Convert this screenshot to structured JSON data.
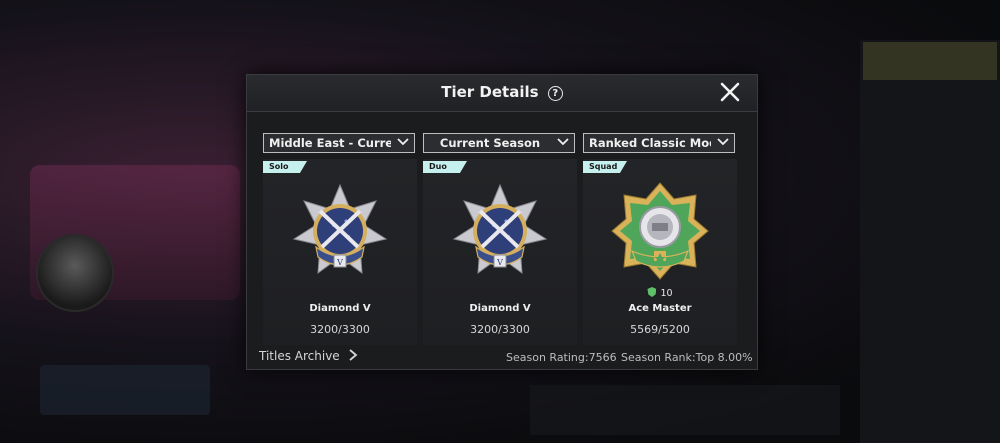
{
  "dialog": {
    "title": "Tier Details",
    "help_glyph": "?",
    "close_glyph": "close"
  },
  "selectors": [
    {
      "value": "Middle East - Current Server"
    },
    {
      "value": "Current Season"
    },
    {
      "value": "Ranked Classic Mode (TPP)"
    }
  ],
  "cards": [
    {
      "mode": "Solo",
      "tier": "Diamond V",
      "points": "3200/3300",
      "badge": "diamond-badge-icon"
    },
    {
      "mode": "Duo",
      "tier": "Diamond V",
      "points": "3200/3300",
      "badge": "diamond-badge-icon"
    },
    {
      "mode": "Squad",
      "tier": "Ace Master",
      "points": "5569/5200",
      "level": "10",
      "badge": "ace-master-badge-icon"
    }
  ],
  "footer": {
    "titles_archive": "Titles Archive",
    "season_rating": "Season Rating:7566",
    "season_rank": "Season Rank:Top 8.00%"
  },
  "colors": {
    "mode_tag": "#c6f0ee",
    "diamond_blue": "#3a4e8c",
    "ace_green": "#4fa65a",
    "gold": "#d9b25a"
  }
}
